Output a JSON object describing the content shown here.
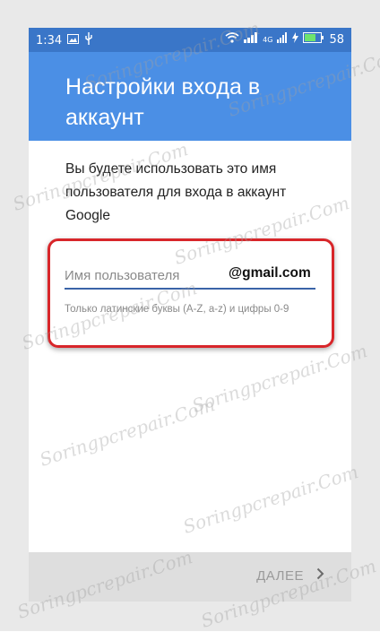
{
  "status_bar": {
    "time": "1:34",
    "lte_label": "4G",
    "battery": "58"
  },
  "header": {
    "title": "Настройки входа в аккаунт"
  },
  "intro": {
    "text": "Вы будете использовать это имя пользователя для входа в аккаунт Google"
  },
  "username": {
    "placeholder": "Имя пользователя",
    "value": "",
    "domain_suffix": "@gmail.com",
    "hint": "Только латинские буквы (A-Z, a-z) и цифры 0-9"
  },
  "footer": {
    "next_label": "ДАЛЕЕ"
  },
  "watermark": {
    "text": "Soringpcrepair.Com"
  },
  "colors": {
    "status_bar": "#3a76c8",
    "header": "#4b8fe5",
    "highlight": "#d8262a",
    "underline": "#3a63a8"
  }
}
